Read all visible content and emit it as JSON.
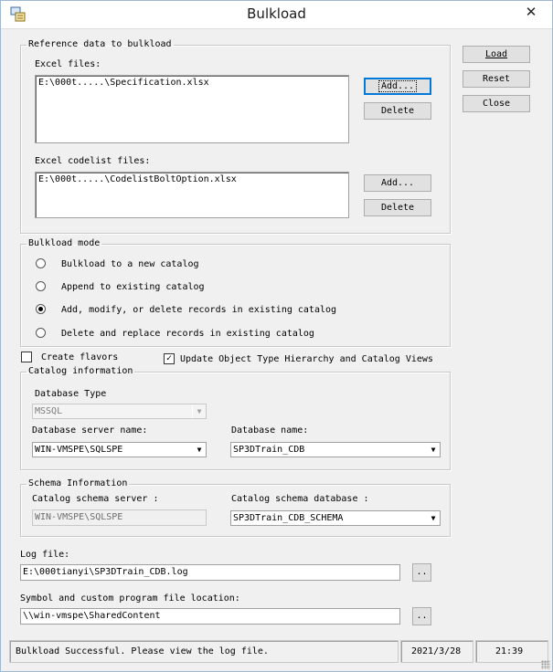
{
  "window": {
    "title": "Bulkload",
    "close_glyph": "✕",
    "app_icon": "bulkload-app-icon"
  },
  "side_buttons": {
    "load": "Load",
    "reset": "Reset",
    "close": "Close"
  },
  "reference": {
    "legend": "Reference data to bulkload",
    "excel_label": "Excel files:",
    "excel_files": [
      "E:\\000t.....\\Specification.xlsx"
    ],
    "add_label": "Add...",
    "delete_label": "Delete",
    "codelist_label": "Excel codelist files:",
    "codelist_files": [
      "E:\\000t.....\\CodelistBoltOption.xlsx"
    ]
  },
  "mode": {
    "legend": "Bulkload mode",
    "options": [
      {
        "label": "Bulkload to a new catalog",
        "checked": false
      },
      {
        "label": "Append to existing  catalog",
        "checked": false
      },
      {
        "label": "Add, modify, or delete records in existing catalog",
        "checked": true
      },
      {
        "label": "Delete and replace records in existing catalog",
        "checked": false
      }
    ]
  },
  "options": {
    "create_flavors_label": "Create flavors",
    "create_flavors_checked": false,
    "update_hierarchy_label": "Update Object Type Hierarchy and Catalog Views",
    "update_hierarchy_checked": true
  },
  "catalog": {
    "legend": "Catalog information",
    "db_type_label": "Database Type",
    "db_type_value": "MSSQL",
    "server_label": "Database server name:",
    "server_value": "WIN-VMSPE\\SQLSPE",
    "db_name_label": "Database name:",
    "db_name_value": "SP3DTrain_CDB"
  },
  "schema": {
    "legend": "Schema Information",
    "server_label": "Catalog schema server :",
    "server_value": "WIN-VMSPE\\SQLSPE",
    "db_label": "Catalog schema database :",
    "db_value": "SP3DTrain_CDB_SCHEMA"
  },
  "log": {
    "label": "Log file:",
    "value": "E:\\000tianyi\\SP3DTrain_CDB.log",
    "browse": "..",
    "symbol_label": "Symbol and custom program file location:",
    "symbol_value": "\\\\win-vmspe\\SharedContent"
  },
  "status": {
    "message": "Bulkload Successful. Please view the log file.",
    "date": "2021/3/28",
    "time": "21:39"
  }
}
